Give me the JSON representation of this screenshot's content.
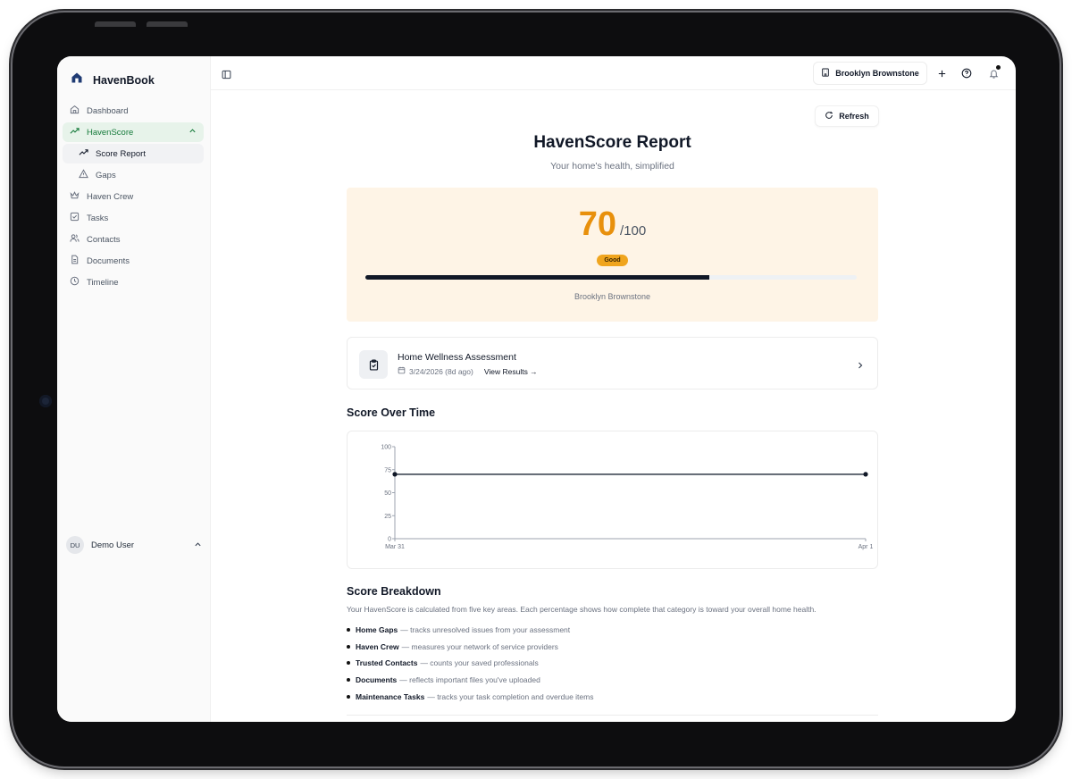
{
  "app": {
    "brand": "HavenBook"
  },
  "sidebar": {
    "items": [
      {
        "label": "Dashboard"
      },
      {
        "label": "HavenScore"
      },
      {
        "label": "Score Report"
      },
      {
        "label": "Gaps"
      },
      {
        "label": "Haven Crew"
      },
      {
        "label": "Tasks"
      },
      {
        "label": "Contacts"
      },
      {
        "label": "Documents"
      },
      {
        "label": "Timeline"
      }
    ],
    "user": {
      "initials": "DU",
      "name": "Demo User"
    }
  },
  "topbar": {
    "property_label": "Brooklyn Brownstone"
  },
  "main": {
    "refresh_label": "Refresh",
    "title": "HavenScore Report",
    "subtitle": "Your home's health, simplified",
    "score": {
      "value": "70",
      "max": "/100",
      "rating": "Good",
      "fraction": 0.7,
      "property": "Brooklyn Brownstone",
      "color": "#e8900c"
    },
    "assessment": {
      "title": "Home Wellness Assessment",
      "date": "3/24/2026 (8d ago)",
      "link": "View Results →"
    },
    "score_over_time_title": "Score Over Time",
    "breakdown": {
      "title": "Score Breakdown",
      "description": "Your HavenScore is calculated from five key areas. Each percentage shows how complete that category is toward your overall home health.",
      "items": [
        {
          "name": "Home Gaps",
          "desc": "— tracks unresolved issues from your assessment"
        },
        {
          "name": "Haven Crew",
          "desc": "— measures your network of service providers"
        },
        {
          "name": "Trusted Contacts",
          "desc": "— counts your saved professionals"
        },
        {
          "name": "Documents",
          "desc": "— reflects important files you've uploaded"
        },
        {
          "name": "Maintenance Tasks",
          "desc": "— tracks your task completion and overdue items"
        }
      ]
    }
  },
  "chart_data": {
    "type": "line",
    "x": [
      "Mar 31",
      "Apr 1"
    ],
    "y_ticks": [
      "0",
      "25",
      "50",
      "75",
      "100"
    ],
    "ylim": [
      0,
      100
    ],
    "series": [
      {
        "values": [
          70,
          70
        ]
      }
    ],
    "grid": false
  }
}
